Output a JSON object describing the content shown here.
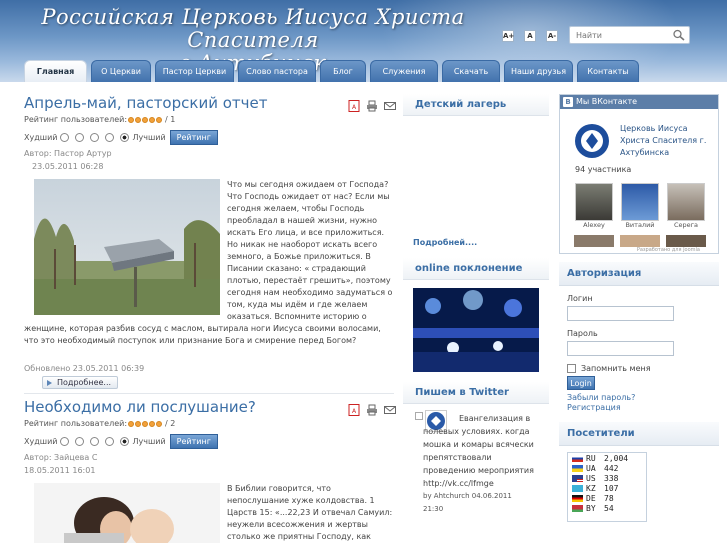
{
  "header": {
    "site_title_line1": "Российская Церковь Иисуса Христа Спасителя",
    "site_title_line2": "г.Ахтубинск",
    "font_buttons": [
      "A+",
      "A",
      "A-"
    ],
    "search_placeholder": "Найти"
  },
  "nav": {
    "tabs": [
      {
        "label": "Главная",
        "active": true
      },
      {
        "label": "О Церкви"
      },
      {
        "label": "Пастор Церкви"
      },
      {
        "label": "Слово пастора"
      },
      {
        "label": "Блог"
      },
      {
        "label": "Служения"
      },
      {
        "label": "Скачать"
      },
      {
        "label": "Наши друзья"
      },
      {
        "label": "Контакты"
      }
    ]
  },
  "articles": [
    {
      "title": "Апрель-май, пасторский отчет",
      "rating_label": "Рейтинг пользователей:",
      "rating_count": "/ 1",
      "vote_worst": "Худший",
      "vote_best": "Лучший",
      "vote_button": "Рейтинг",
      "author": "Автор: Пастор Артур",
      "date": "23.05.2011 06:28",
      "body_text": "Что мы сегодня ожидаем от Господа? Что Господь ожидает от нас? Если мы сегодня желаем, чтобы Господь преобладал в нашей жизни, нужно искать Его лица, и все приложиться. Но никак не наоборот искать всего земного, а Божье приложиться. В Писании сказано: « страдающий плотью, перестаёт грешить», поэтому сегодня нам необходимо задуматься о том, куда мы идём и где желаем оказаться. Вспомните историю о женщине, которая разбив сосуд с маслом, вытирала ноги Иисуса своими волосами, что это необходимый поступок или признание Бога и смирение перед Богом?",
      "updated": "Обновлено 23.05.2011 06:39",
      "more_button": "Подробнее..."
    },
    {
      "title": "Необходимо ли послушание?",
      "rating_label": "Рейтинг пользователей:",
      "rating_count": "/ 2",
      "vote_worst": "Худший",
      "vote_best": "Лучший",
      "vote_button": "Рейтинг",
      "author": "Автор: Зайцева С",
      "date": "18.05.2011 16:01",
      "body_text": "В Библии говорится, что непослушание хуже колдовства. 1 Царств 15: «...22,23 И отвечал Самуил: неужели всесожжения и жертвы столько же приятны Господу, как"
    }
  ],
  "middle": {
    "camp_title": "Детский лагерь",
    "camp_more": "Подробней....",
    "worship_title": "online поклонение",
    "twitter_title": "Пишем в Twitter",
    "tweet_text": "Евангелизация в полевых условиях. когда мошка и комары всячески препятствовали проведению мероприятия http://vk.cc/lfmge",
    "tweet_meta": "by Ahtchurch 04.06.2011 21:30"
  },
  "vk": {
    "header": "Мы ВКонтакте",
    "group_name": "Церковь Иисуса Христа Спасителя г. Ахтубинска",
    "members": "94 участника",
    "people": [
      "Alexey",
      "Виталий",
      "Серега"
    ],
    "footer": "Разработано для Joomla"
  },
  "auth": {
    "title": "Авторизация",
    "login_label": "Логин",
    "password_label": "Пароль",
    "remember_label": "Запомнить меня",
    "login_button": "Login",
    "forgot_link": "Забыли пароль?",
    "register_link": "Регистрация"
  },
  "visitors": {
    "title": "Посетители",
    "rows": [
      {
        "code": "RU",
        "count": "2,004"
      },
      {
        "code": "UA",
        "count": "442"
      },
      {
        "code": "US",
        "count": "338"
      },
      {
        "code": "KZ",
        "count": "107"
      },
      {
        "code": "DE",
        "count": "78"
      },
      {
        "code": "BY",
        "count": "54"
      }
    ]
  },
  "colors": {
    "accent": "#3b6ea5",
    "header_top": "#3f6ea6",
    "button": "#3f73b0",
    "rating_star": "#f2a13b"
  }
}
